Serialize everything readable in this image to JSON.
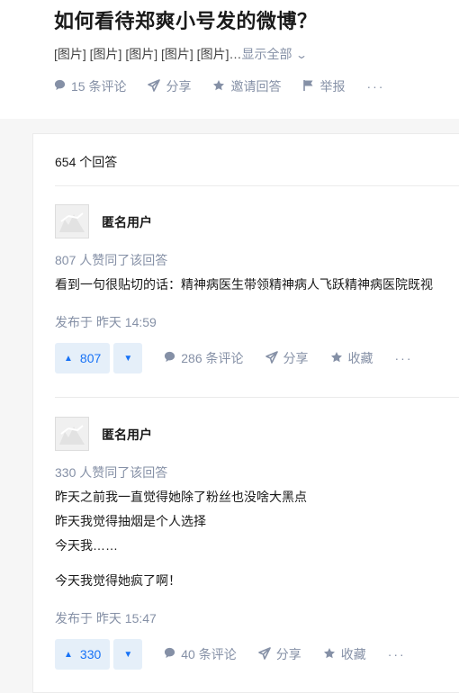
{
  "question": {
    "title": "如何看待郑爽小号发的微博？",
    "excerpt": "[图片] [图片] [图片] [图片] [图片]…",
    "show_all": "显示全部",
    "actions": {
      "comments": "15 条评论",
      "share": "分享",
      "invite": "邀请回答",
      "report": "举报",
      "more": "···"
    }
  },
  "answers_count": "654 个回答",
  "answers": [
    {
      "author": "匿名用户",
      "votes_text": "807 人赞同了该回答",
      "content": [
        "看到一句很贴切的话：精神病医生带领精神病人飞跃精神病医院既视"
      ],
      "published": "发布于 昨天 14:59",
      "upvote": "807",
      "comments": "286 条评论",
      "share": "分享",
      "collect": "收藏",
      "more": "···"
    },
    {
      "author": "匿名用户",
      "votes_text": "330 人赞同了该回答",
      "content": [
        "昨天之前我一直觉得她除了粉丝也没啥大黑点",
        "昨天我觉得抽烟是个人选择",
        "今天我……",
        "今天我觉得她疯了啊！"
      ],
      "published": "发布于 昨天 15:47",
      "upvote": "330",
      "comments": "40 条评论",
      "share": "分享",
      "collect": "收藏",
      "more": "···"
    }
  ],
  "icons": {
    "comment": "comment-icon",
    "share": "share-icon",
    "star": "star-icon",
    "flag": "flag-icon",
    "up": "upvote-triangle-icon",
    "down": "downvote-triangle-icon"
  },
  "colors": {
    "accent": "#1772f6",
    "vote_bg": "#e5eff9",
    "muted": "#8590a6"
  }
}
